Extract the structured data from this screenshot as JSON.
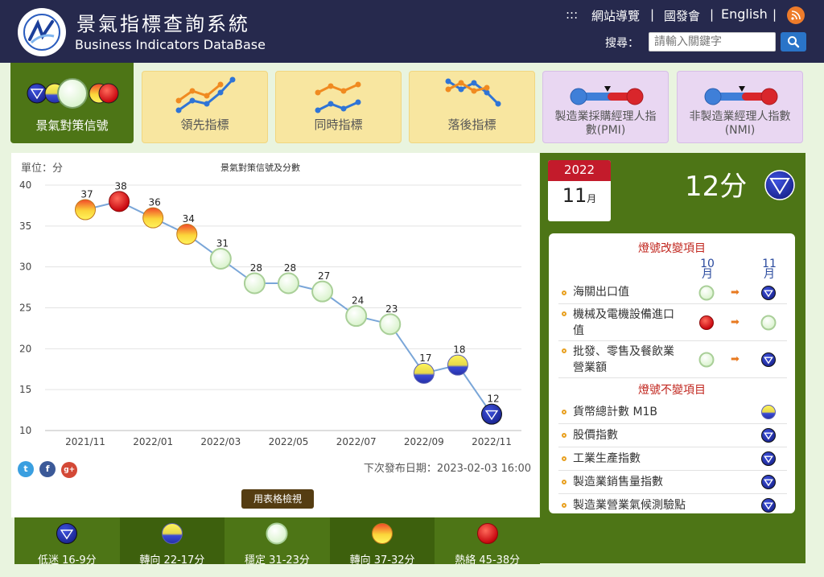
{
  "header": {
    "title_cn": "景氣指標查詢系統",
    "title_en": "Business Indicators DataBase",
    "nav": [
      ":::",
      "網站導覽",
      "|",
      "國發會",
      "|",
      "English",
      "|"
    ],
    "search_label": "搜尋：",
    "search_placeholder": "請輸入關鍵字",
    "colors": {
      "bg": "#26294d",
      "rss": "#ee7b2a",
      "search_btn": "#2a74c8"
    }
  },
  "tabs": [
    {
      "label": "景氣對策信號",
      "active": true
    },
    {
      "label": "領先指標"
    },
    {
      "label": "同時指標"
    },
    {
      "label": "落後指標"
    },
    {
      "label": "製造業採購經理人指數(PMI)"
    },
    {
      "label": "非製造業經理人指數(NMI)"
    }
  ],
  "chart": {
    "unit": "單位：分",
    "title": "景氣對策信號及分數",
    "next_release": "下次發布日期：2023-02-03 16:00",
    "table_button": "用表格檢視",
    "social_icons": [
      "twitter-icon",
      "facebook-icon",
      "google-plus-icon"
    ]
  },
  "chart_data": {
    "type": "line",
    "title": "景氣對策信號及分數",
    "ylabel": "單位：分",
    "ylim": [
      10,
      40
    ],
    "yticks": [
      10,
      15,
      20,
      25,
      30,
      35,
      40
    ],
    "xtick_labels": [
      "2021/11",
      "2022/01",
      "2022/03",
      "2022/05",
      "2022/07",
      "2022/09",
      "2022/11"
    ],
    "x": [
      "2021/11",
      "2021/12",
      "2022/01",
      "2022/02",
      "2022/03",
      "2022/04",
      "2022/05",
      "2022/06",
      "2022/07",
      "2022/08",
      "2022/09",
      "2022/10",
      "2022/11"
    ],
    "values": [
      37,
      38,
      36,
      34,
      31,
      28,
      28,
      27,
      24,
      23,
      17,
      18,
      12
    ],
    "signals": [
      "yellow-red",
      "red",
      "yellow-red",
      "yellow-red",
      "green",
      "green",
      "green",
      "green",
      "green",
      "green",
      "yellow-blue",
      "yellow-blue",
      "blue"
    ],
    "grid": true
  },
  "legend": [
    {
      "label": "低迷 16-9分",
      "signal": "blue"
    },
    {
      "label": "轉向 22-17分",
      "signal": "yellow-blue"
    },
    {
      "label": "穩定 31-23分",
      "signal": "green"
    },
    {
      "label": "轉向 37-32分",
      "signal": "yellow-red"
    },
    {
      "label": "熱絡 45-38分",
      "signal": "red"
    }
  ],
  "current": {
    "year": "2022",
    "month": "11",
    "month_unit": "月",
    "score": "12分",
    "signal": "blue"
  },
  "changed": {
    "heading": "燈號改變項目",
    "from_month": "10月",
    "to_month": "11月",
    "items": [
      {
        "name": "海關出口值",
        "from": "green",
        "to": "blue"
      },
      {
        "name": "機械及電機設備進口值",
        "from": "red",
        "to": "green"
      },
      {
        "name": "批發、零售及餐飲業營業額",
        "from": "green",
        "to": "blue"
      }
    ]
  },
  "unchanged": {
    "heading": "燈號不變項目",
    "items": [
      {
        "name": "貨幣總計數 M1B",
        "signal": "yellow-blue"
      },
      {
        "name": "股價指數",
        "signal": "blue"
      },
      {
        "name": "工業生產指數",
        "signal": "blue"
      },
      {
        "name": "製造業銷售量指數",
        "signal": "blue"
      },
      {
        "name": "製造業營業氣候測驗點",
        "signal": "blue"
      }
    ]
  },
  "colors": {
    "panel_green": "#4d7516",
    "accent_red": "#c31b2b",
    "line": "#7aa6d8"
  }
}
